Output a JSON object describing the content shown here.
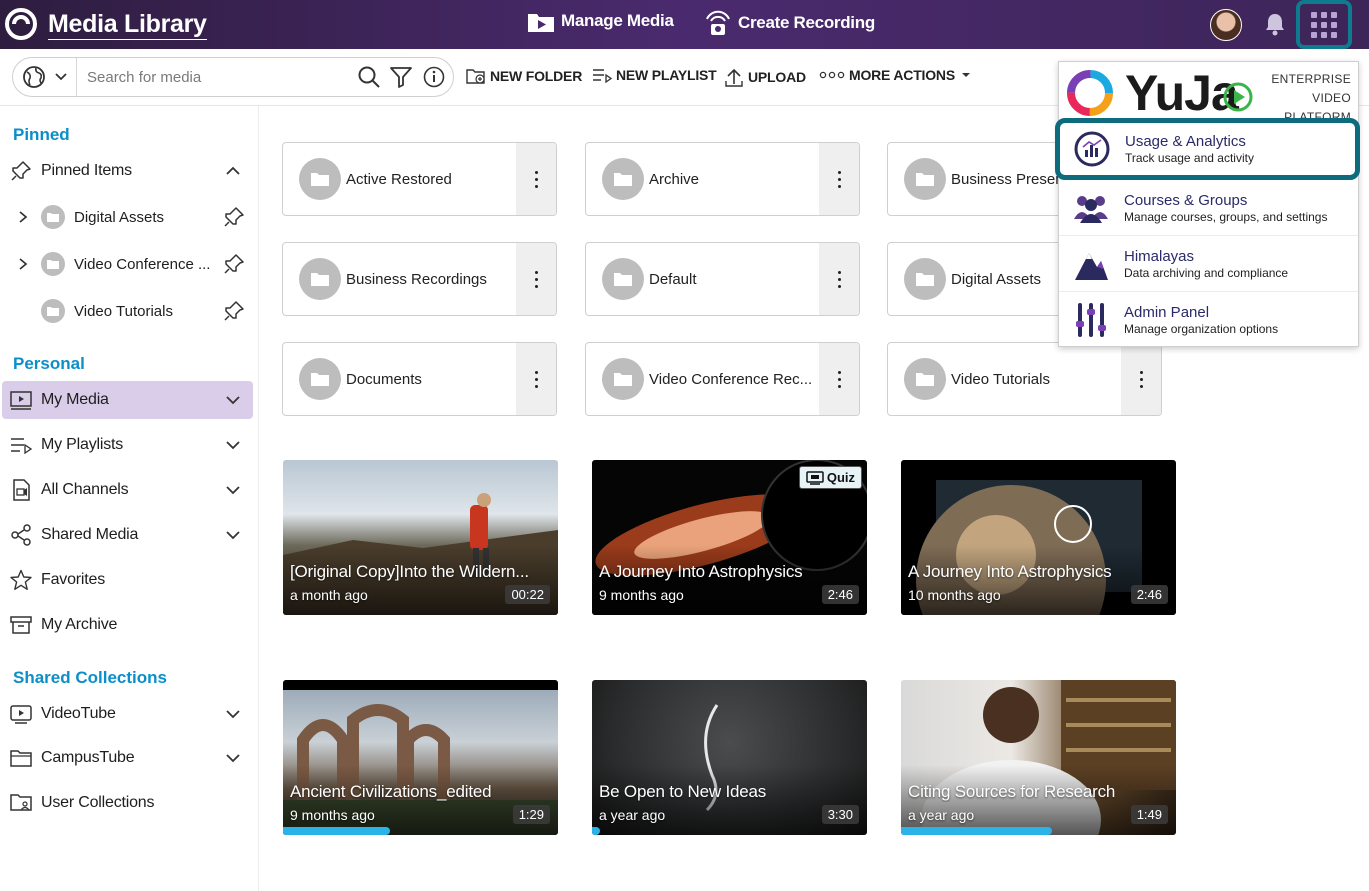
{
  "topbar": {
    "app_title": "Media Library",
    "nav_manage": "Manage Media",
    "nav_record": "Create Recording"
  },
  "toolbar": {
    "search_placeholder": "Search for media",
    "new_folder": "NEW FOLDER",
    "new_playlist": "NEW PLAYLIST",
    "upload": "UPLOAD",
    "more_actions": "MORE ACTIONS"
  },
  "sidebar": {
    "pinned_title": "Pinned",
    "pinned_items_label": "Pinned Items",
    "pinned": [
      "Digital Assets",
      "Video Conference ...",
      "Video Tutorials"
    ],
    "personal_title": "Personal",
    "personal": [
      "My Media",
      "My Playlists",
      "All Channels",
      "Shared Media",
      "Favorites",
      "My Archive"
    ],
    "shared_title": "Shared Collections",
    "shared": [
      "VideoTube",
      "CampusTube",
      "User Collections"
    ]
  },
  "folders": [
    "Active Restored",
    "Archive",
    "Business Present",
    "Business Recordings",
    "Default",
    "Digital Assets",
    "Documents",
    "Video Conference Rec...",
    "Video Tutorials"
  ],
  "videos": [
    {
      "title": "[Original Copy]Into the Wildern...",
      "age": "a month ago",
      "duration": "00:22",
      "progress": 0
    },
    {
      "title": "A Journey Into Astrophysics",
      "age": "9 months ago",
      "duration": "2:46",
      "progress": 0,
      "badge": "Quiz"
    },
    {
      "title": "A Journey Into Astrophysics",
      "age": "10 months ago",
      "duration": "2:46",
      "progress": 0
    },
    {
      "title": "Ancient Civilizations_edited",
      "age": "9 months ago",
      "duration": "1:29",
      "progress": 0.39
    },
    {
      "title": "Be Open to New Ideas",
      "age": "a year ago",
      "duration": "3:30",
      "progress": 0.03
    },
    {
      "title": "Citing Sources for Research",
      "age": "a year ago",
      "duration": "1:49",
      "progress": 0.55
    }
  ],
  "apps_menu": {
    "brand": "YuJa",
    "tagline": [
      "ENTERPRISE",
      "VIDEO",
      "PLATFORM"
    ],
    "items": [
      {
        "title": "Usage & Analytics",
        "subtitle": "Track usage and activity"
      },
      {
        "title": "Courses & Groups",
        "subtitle": "Manage courses, groups, and settings"
      },
      {
        "title": "Himalayas",
        "subtitle": "Data archiving and compliance"
      },
      {
        "title": "Admin Panel",
        "subtitle": "Manage organization options"
      }
    ]
  },
  "colors": {
    "accent": "#0b8fc9",
    "topbar": "#3d2558",
    "highlight": "#0e6b7d",
    "progress": "#2bb3e8"
  }
}
